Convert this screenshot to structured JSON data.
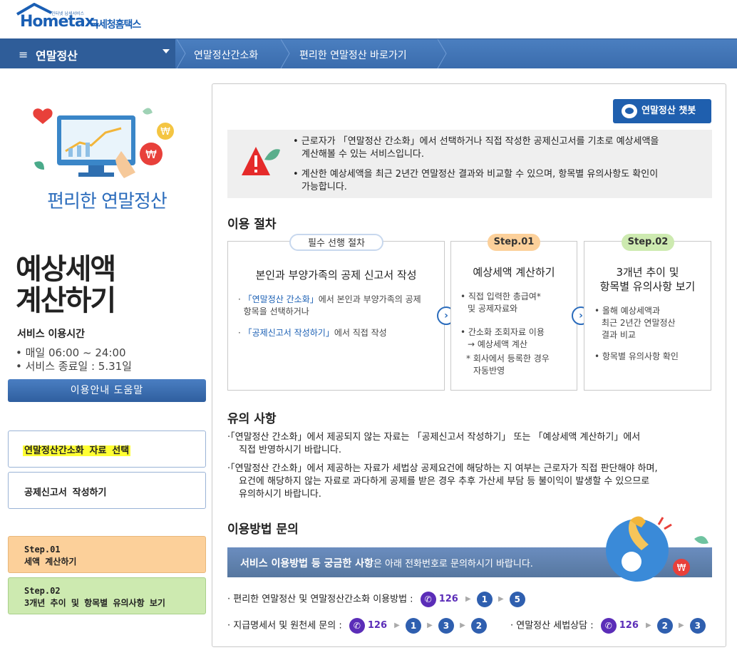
{
  "header": {
    "brand": "Hometax.",
    "brand_sub": "국세청홈택스",
    "tagline": "인터넷 납세서비스"
  },
  "nav": {
    "menu_title": "연말정산",
    "items": [
      "연말정산간소화",
      "편리한 연말정산 바로가기"
    ]
  },
  "left": {
    "illustration_title": "편리한 연말정산",
    "page_title_line1": "예상세액",
    "page_title_line2": "계산하기",
    "service_label": "서비스 이용시간",
    "service_hours": "• 매일 06:00 ~ 24:00",
    "service_end": "• 서비스 종료일 : 5.31일",
    "help_button": "이용안내 도움말",
    "menu_items": [
      "연말정산간소화 자료 선택",
      "공제신고서 작성하기"
    ],
    "step1_label": "Step.01",
    "step1_text": "세액 계산하기",
    "step2_label": "Step.02",
    "step2_text": "3개년 추이 및 항목별 유의사항 보기"
  },
  "main": {
    "chatbot_button": "연말정산 챗봇",
    "notice_1a": "• 근로자가 「연말정산 간소화」에서 선택하거나 직접 작성한 공제신고서를 기초로 예상세액을",
    "notice_1b": "계산해볼 수 있는 서비스입니다.",
    "notice_2a": "• 계산한 예상세액을 최근 2년간 연말정산 결과와 비교할 수 있으며, 항목별 유의사항도 확인이",
    "notice_2b": "가능합니다.",
    "procedure_title": "이용 절차",
    "pre_pill": "필수 선행 절차",
    "pre_head": "본인과 부양가족의 공제 신고서 작성",
    "pre_b1a_quote": "「연말정산 간소화」",
    "pre_b1a_rest": "에서 본인과 부양가족의 공제",
    "pre_b1b": "항목을 선택하거나",
    "pre_b2_quote": "「공제신고서 작성하기」",
    "pre_b2_rest": "에서 직접 작성",
    "step1_pill": "Step.01",
    "step1_head": "예상세액 계산하기",
    "step1_b1a": "• 직접 입력한 총급여*",
    "step1_b1b": "및 공제자료와",
    "step1_b2a": "• 간소화 조회자료 이용",
    "step1_b2b": "→ 예상세액 계산",
    "step1_b3a": "* 회사에서 등록한 경우",
    "step1_b3b": "자동반영",
    "step2_pill": "Step.02",
    "step2_head_a": "3개년 추이 및",
    "step2_head_b": "항목별 유의사항 보기",
    "step2_b1a": "• 올해 예상세액과",
    "step2_b1b": "최근 2년간 연말정산",
    "step2_b1c": "결과 비교",
    "step2_b2": "• 항목별 유의사항 확인",
    "caution_title": "유의 사항",
    "caution_1a": "·「연말정산 간소화」에서 제공되지 않는 자료는 「공제신고서 작성하기」 또는 「예상세액 계산하기」에서",
    "caution_1b": "직접 반영하시기 바랍니다.",
    "caution_2a": "·「연말정산 간소화」에서 제공하는 자료가 세법상 공제요건에 해당하는 지 여부는 근로자가 직접 판단해야 하며,",
    "caution_2b": "요건에 해당하지 않는 자료로 과다하게 공제를 받은 경우 추후 가산세 부담 등 불이익이 발생할 수 있으므로",
    "caution_2c": "유의하시기 바랍니다.",
    "inquiry_title": "이용방법 문의",
    "banner_bold": "서비스 이용방법 등 궁금한 사항",
    "banner_rest": "은 아래 전화번호로 문의하시기 바랍니다.",
    "phone1_label": "· 편리한 연말정산 및 연말정산간소화 이용방법 :",
    "phone2_label": "· 지급명세서 및 원천세 문의 :",
    "phone3_label": "· 연말정산 세법상담 :",
    "phone_main": "126",
    "phone1_keys": [
      "1",
      "5"
    ],
    "phone2_keys": [
      "1",
      "3",
      "2"
    ],
    "phone3_keys": [
      "2",
      "3"
    ]
  },
  "colors": {
    "nav_blue": "#3a6cad",
    "step1_orange": "#fcd09a",
    "step2_green": "#cdeab0",
    "phone_purple": "#5b2db8",
    "key_blue": "#2f5faf"
  }
}
